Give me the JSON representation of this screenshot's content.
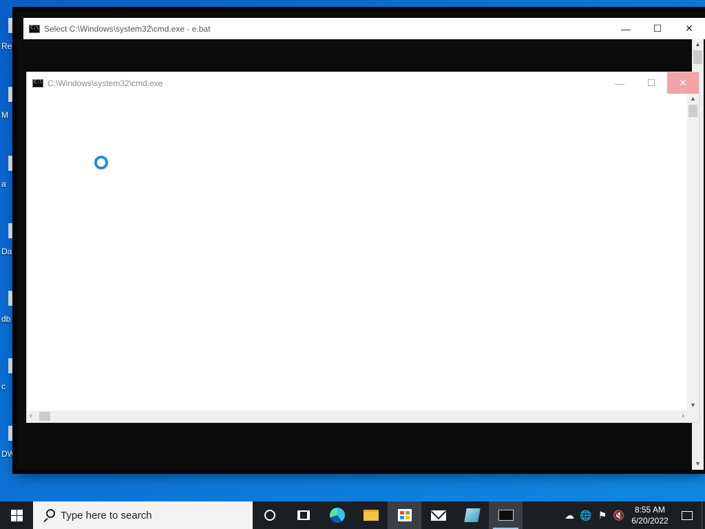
{
  "desktop": {
    "icon_labels": [
      "Re",
      "M",
      "a",
      "Dat",
      "db",
      "c",
      "DWM"
    ]
  },
  "back_window": {
    "title": "Select C:\\Windows\\system32\\cmd.exe - e.bat",
    "minimize_glyph": "—",
    "maximize_glyph": "☐",
    "close_glyph": "✕"
  },
  "front_window": {
    "title": "C:\\Windows\\system32\\cmd.exe",
    "minimize_glyph": "—",
    "maximize_glyph": "☐",
    "close_glyph": "✕",
    "state": "not-responding-loading"
  },
  "taskbar": {
    "search_placeholder": "Type here to search",
    "pinned": [
      "cortana",
      "task-view",
      "edge",
      "file-explorer",
      "store",
      "mail",
      "app",
      "cmd"
    ],
    "clock_time": "8:55 AM",
    "clock_date": "6/20/2022"
  },
  "tray": {
    "icons": [
      "onedrive-icon",
      "network-icon",
      "security-warning-icon",
      "volume-muted-icon"
    ]
  },
  "colors": {
    "desktop": "#0b74d6",
    "taskbar": "#1b1f24",
    "console_bg": "#0c0c0c",
    "spinner": "#2b88d8",
    "close_hover": "#f1a3a8"
  }
}
